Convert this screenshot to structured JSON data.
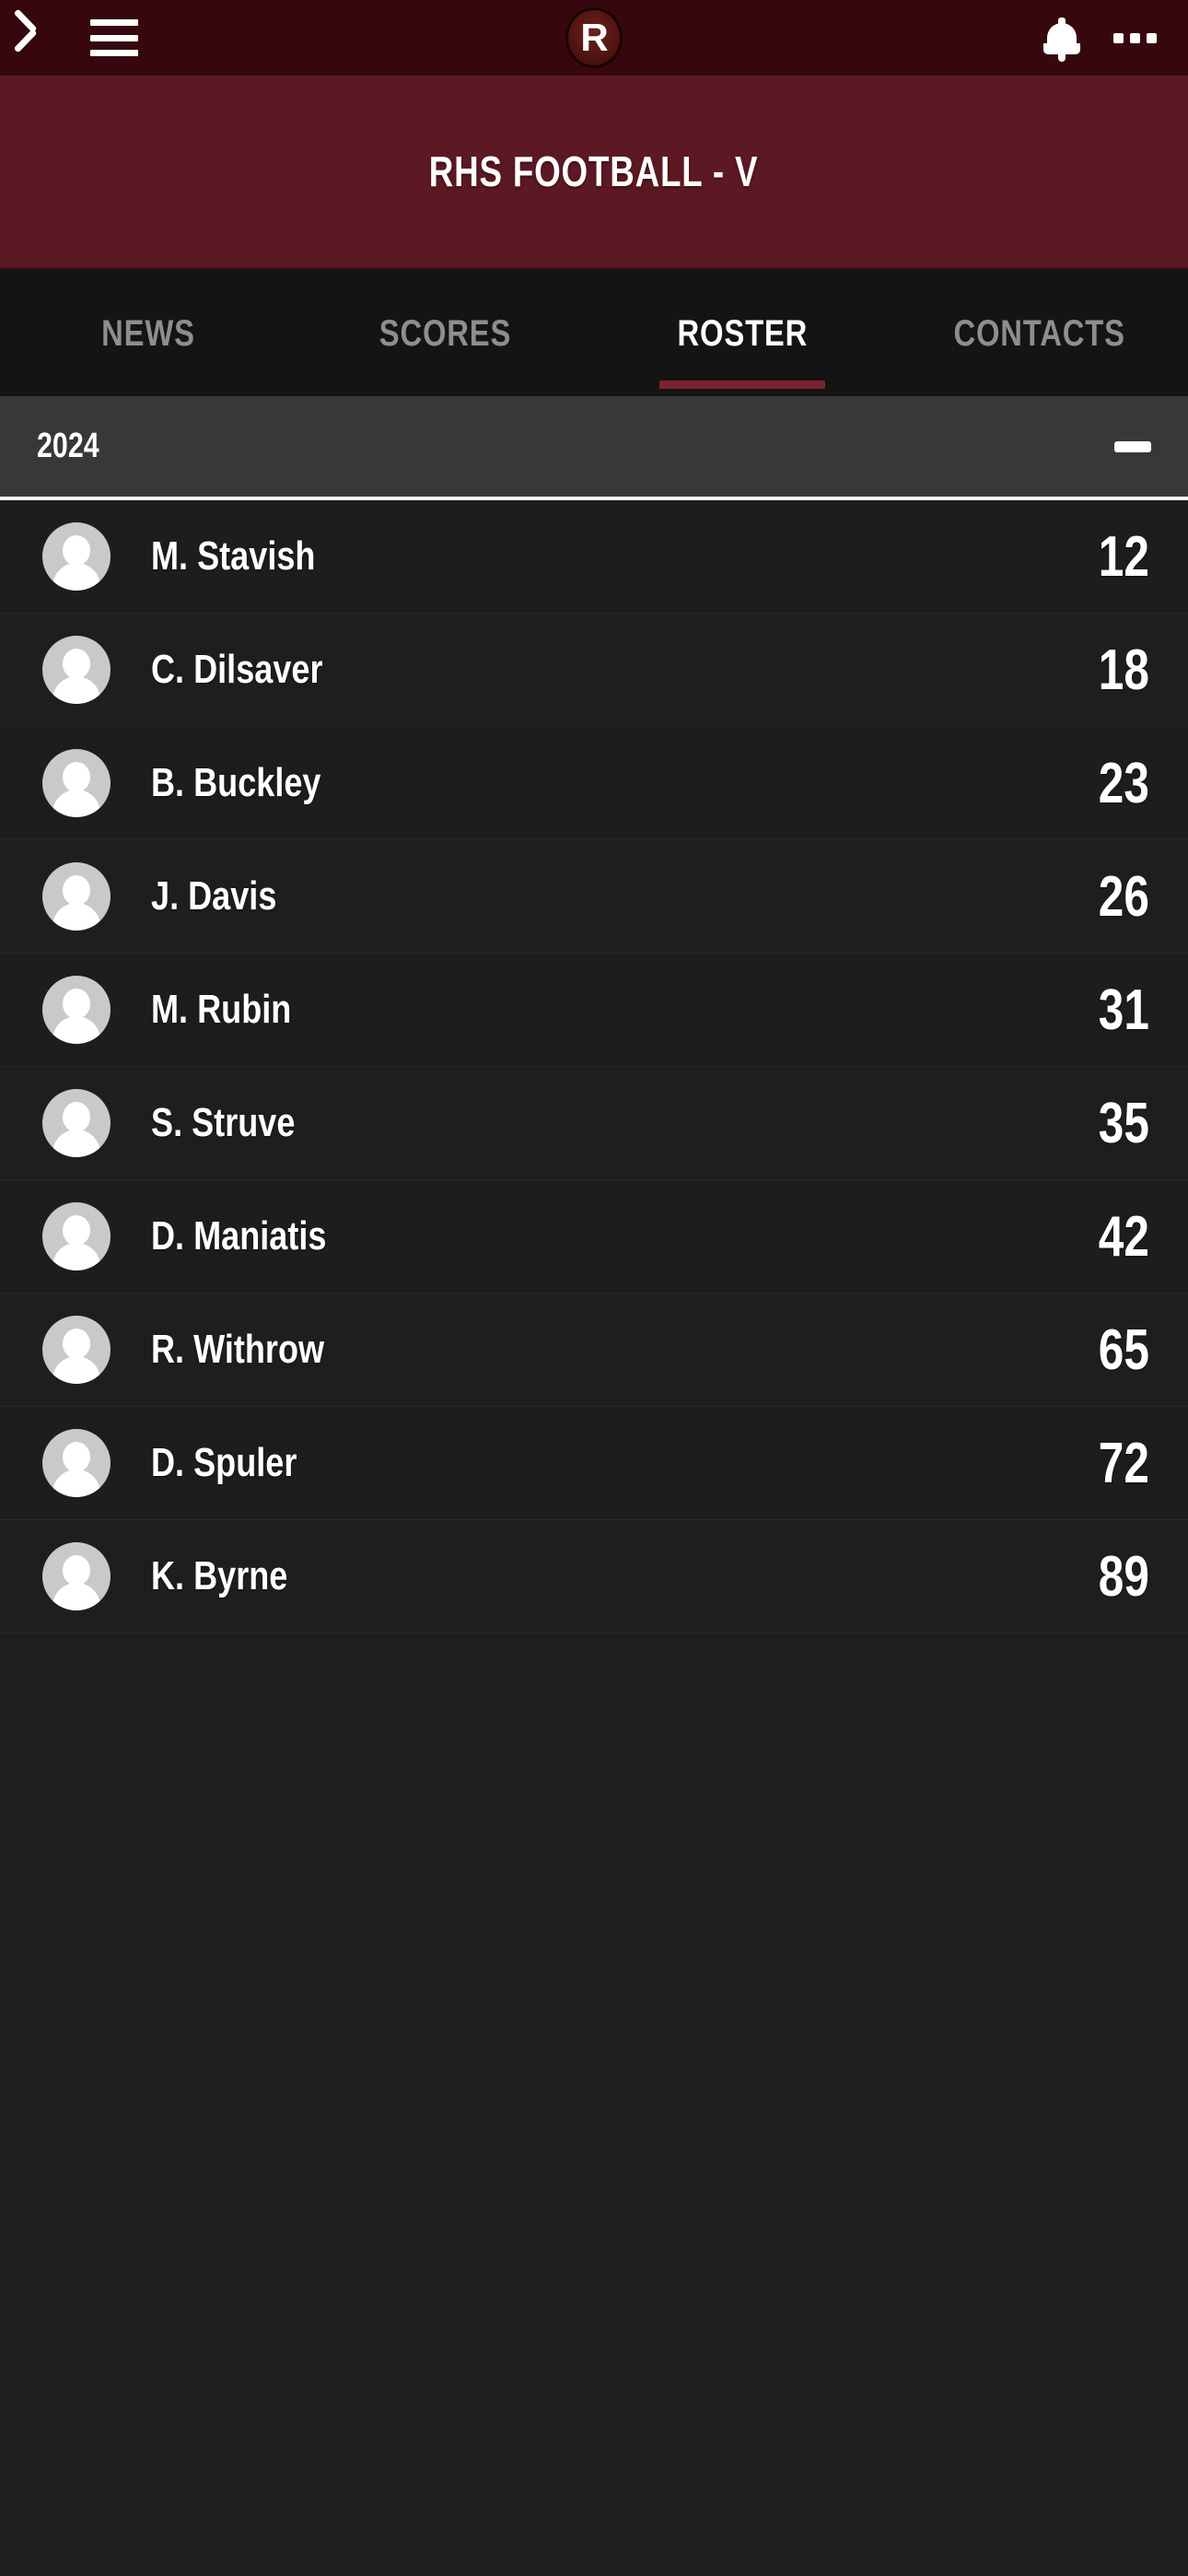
{
  "topbar": {
    "background_color": "#36080D",
    "back_icon": "back-chevron-icon",
    "menu_icon": "hamburger-menu-icon",
    "logo_letter": "R",
    "bell_icon": "notification-bell-icon",
    "overflow_icon": "more-options-icon"
  },
  "header": {
    "title": "RHS FOOTBALL - V",
    "background_color": "#5C1823"
  },
  "tabs": [
    {
      "label": "NEWS",
      "active": false
    },
    {
      "label": "SCORES",
      "active": false
    },
    {
      "label": "ROSTER",
      "active": true
    },
    {
      "label": "CONTACTS",
      "active": false
    }
  ],
  "accent_color": "#7A2230",
  "section": {
    "year": "2024",
    "collapse_icon": "minus-icon",
    "expanded": true,
    "background_color": "#383838"
  },
  "roster": [
    {
      "name": "M. Stavish",
      "number": "12",
      "avatar": "default-avatar-icon"
    },
    {
      "name": "C. Dilsaver",
      "number": "18",
      "avatar": "default-avatar-icon"
    },
    {
      "name": "B. Buckley",
      "number": "23",
      "avatar": "default-avatar-icon"
    },
    {
      "name": "J. Davis",
      "number": "26",
      "avatar": "default-avatar-icon"
    },
    {
      "name": "M. Rubin",
      "number": "31",
      "avatar": "default-avatar-icon"
    },
    {
      "name": "S. Struve",
      "number": "35",
      "avatar": "default-avatar-icon"
    },
    {
      "name": "D. Maniatis",
      "number": "42",
      "avatar": "default-avatar-icon"
    },
    {
      "name": "R. Withrow",
      "number": "65",
      "avatar": "default-avatar-icon"
    },
    {
      "name": "D. Spuler",
      "number": "72",
      "avatar": "default-avatar-icon"
    },
    {
      "name": "K. Byrne",
      "number": "89",
      "avatar": "default-avatar-icon"
    }
  ]
}
